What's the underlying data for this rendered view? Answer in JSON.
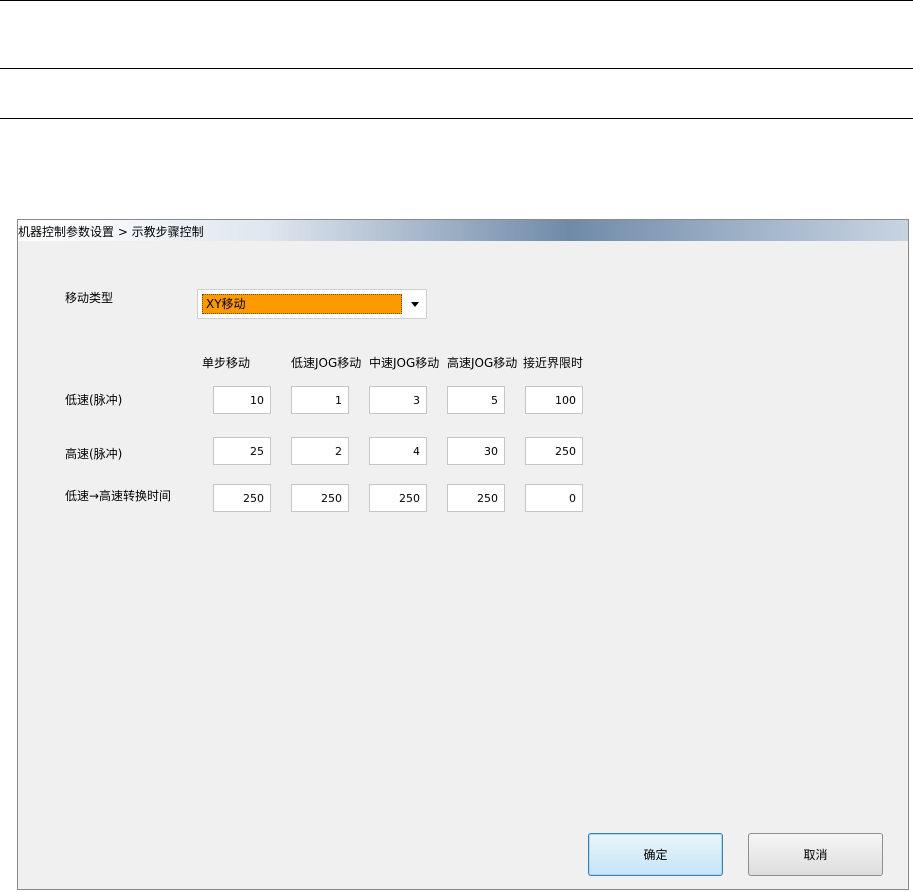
{
  "dialog": {
    "title": "机器控制参数设置 > 示教步骤控制"
  },
  "move_type": {
    "label": "移动类型",
    "selected": "XY移动"
  },
  "columns": [
    "单步移动",
    "低速JOG移动",
    "中速JOG移动",
    "高速JOG移动",
    "接近界限时"
  ],
  "rows": [
    {
      "label": "低速(脉冲)",
      "values": [
        "10",
        "1",
        "3",
        "5",
        "100"
      ]
    },
    {
      "label": "高速(脉冲)",
      "values": [
        "25",
        "2",
        "4",
        "30",
        "250"
      ]
    },
    {
      "label": "低速→高速转换时间",
      "values": [
        "250",
        "250",
        "250",
        "250",
        "0"
      ]
    }
  ],
  "buttons": {
    "ok": "确定",
    "cancel": "取消"
  },
  "colors": {
    "selected_highlight": "#ff9900",
    "ok_button_border": "#3c7fb1"
  }
}
